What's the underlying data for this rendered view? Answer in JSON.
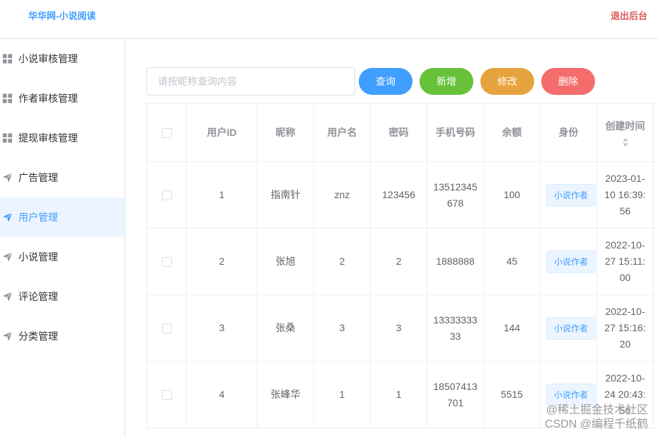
{
  "header": {
    "brand": "华华网-小说阅读",
    "logout": "退出后台"
  },
  "sidebar": {
    "items": [
      {
        "label": "小说审核管理",
        "icon": "grid-icon"
      },
      {
        "label": "作者审核管理",
        "icon": "grid-icon"
      },
      {
        "label": "提现审核管理",
        "icon": "grid-icon"
      },
      {
        "label": "广告管理",
        "icon": "paper-plane-icon"
      },
      {
        "label": "用户管理",
        "icon": "paper-plane-icon",
        "active": true
      },
      {
        "label": "小说管理",
        "icon": "paper-plane-icon"
      },
      {
        "label": "评论管理",
        "icon": "paper-plane-icon"
      },
      {
        "label": "分类管理",
        "icon": "paper-plane-icon"
      }
    ]
  },
  "toolbar": {
    "search_placeholder": "请按昵称查询内容",
    "query_label": "查询",
    "add_label": "新增",
    "edit_label": "修改",
    "delete_label": "删除"
  },
  "table": {
    "columns": [
      "用户ID",
      "昵称",
      "用户名",
      "密码",
      "手机号码",
      "余额",
      "身份",
      "创建时间"
    ],
    "rows": [
      {
        "id": "1",
        "nickname": "指南针",
        "username": "znz",
        "password": "123456",
        "phone": "13512345678",
        "balance": "100",
        "role": "小说作者",
        "created": "2023-01-10 16:39:56"
      },
      {
        "id": "2",
        "nickname": "张旭",
        "username": "2",
        "password": "2",
        "phone": "1888888",
        "balance": "45",
        "role": "小说作者",
        "created": "2022-10-27 15:11:00"
      },
      {
        "id": "3",
        "nickname": "张桑",
        "username": "3",
        "password": "3",
        "phone": "1333333333",
        "balance": "144",
        "role": "小说作者",
        "created": "2022-10-27 15:16:20"
      },
      {
        "id": "4",
        "nickname": "张峰华",
        "username": "1",
        "password": "1",
        "phone": "18507413701",
        "balance": "5515",
        "role": "小说作者",
        "created": "2022-10-24 20:43:50"
      }
    ]
  },
  "watermark": {
    "line1": "@稀土掘金技术社区",
    "line2": "CSDN @编程千纸鹤"
  },
  "colors": {
    "primary": "#409eff",
    "success": "#67c23a",
    "warning": "#e6a23c",
    "danger": "#f56c6c",
    "logout": "#e05a5a"
  }
}
